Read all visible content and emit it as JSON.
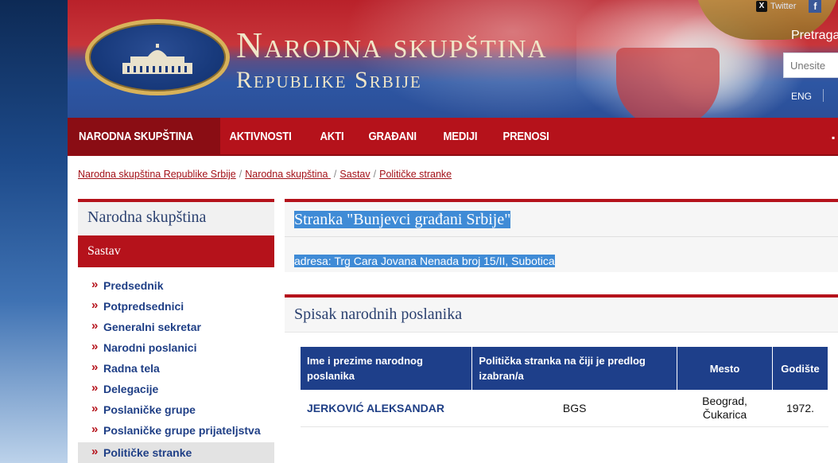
{
  "header": {
    "title_line1": "Narodna skupština",
    "title_line2": "Republike Srbije",
    "social_twitter": "Twitter",
    "search_label": "Pretraga",
    "search_placeholder": "Unesite",
    "lang": "ENG"
  },
  "nav": {
    "items": [
      {
        "label": "NARODNA SKUPŠTINA",
        "active": true
      },
      {
        "label": "AKTIVNOSTI"
      },
      {
        "label": "AKTI"
      },
      {
        "label": "GRAĐANI"
      },
      {
        "label": "MEDIJI"
      },
      {
        "label": "PRENOSI"
      }
    ]
  },
  "breadcrumb": [
    "Narodna skupština Republike Srbije",
    "Narodna skupština ",
    "Sastav",
    "Političke stranke"
  ],
  "sidebar": {
    "heading": "Narodna skupština",
    "section": "Sastav",
    "items": [
      "Predsednik",
      "Potpredsednici",
      "Generalni sekretar",
      "Narodni poslanici",
      "Radna tela",
      "Delegacije",
      "Poslaničke grupe",
      "Poslaničke grupe prijateljstva",
      "Političke stranke"
    ]
  },
  "party": {
    "title": "Stranka \"Bunjevci građani Srbije\"",
    "address": "adresa: Trg Cara Jovana Nenada broj 15/II, Subotica"
  },
  "members": {
    "title": "Spisak narodnih poslanika",
    "columns": [
      "Ime i prezime narodnog poslanika",
      "Politička stranka na čiji je predlog izabran/a",
      "Mesto",
      "Godište"
    ],
    "rows": [
      {
        "name": "JERKOVIĆ ALEKSANDAR",
        "party": "BGS",
        "place": "Beograd, Čukarica",
        "year": "1972."
      }
    ]
  }
}
